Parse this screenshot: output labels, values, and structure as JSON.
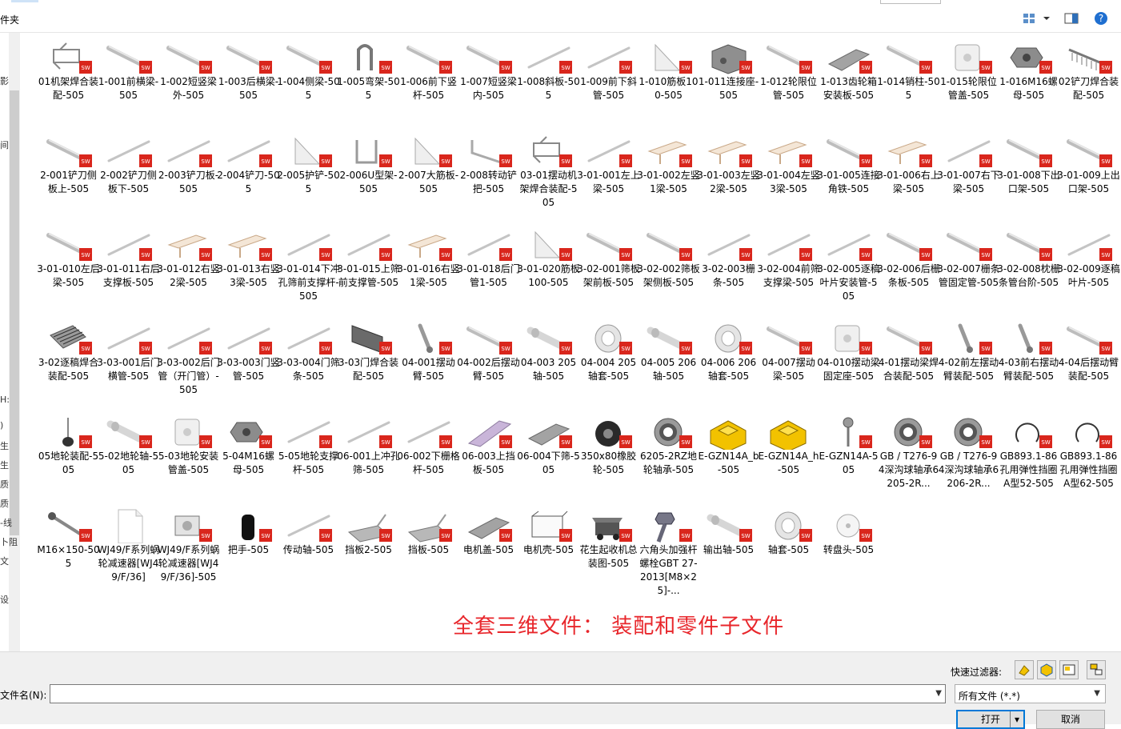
{
  "header": {
    "folder_label_fragment": "件夹"
  },
  "toolbar": {
    "view_icon": "view-mode-icon",
    "dropdown_icon": "chevron-down-icon",
    "preview_pane_icon": "preview-pane-icon",
    "help_icon": "help-icon"
  },
  "left_pane_fragments": [
    "影",
    "间",
    "H:",
    ")",
    "生",
    "生",
    "质",
    "质",
    "-线",
    "卜阻",
    "文",
    "设"
  ],
  "files": [
    {
      "label": "01机架焊合装配-505",
      "shape": "frame",
      "sw": true
    },
    {
      "label": "1-001前横梁-505",
      "shape": "rod",
      "sw": true
    },
    {
      "label": "1-002短竖梁外-505",
      "shape": "rod",
      "sw": true
    },
    {
      "label": "1-003后横梁-505",
      "shape": "rod",
      "sw": true
    },
    {
      "label": "1-004侧梁-505",
      "shape": "rod",
      "sw": true
    },
    {
      "label": "1-005弯架-505",
      "shape": "hook",
      "sw": true
    },
    {
      "label": "1-006前下竖杆-505",
      "shape": "rod",
      "sw": true
    },
    {
      "label": "1-007短竖梁内-505",
      "shape": "rod",
      "sw": true
    },
    {
      "label": "1-008斜板-505",
      "shape": "thinrod",
      "sw": true
    },
    {
      "label": "1-009前下斜管-505",
      "shape": "thinrod",
      "sw": true
    },
    {
      "label": "1-010筋板100-505",
      "shape": "plate",
      "sw": true
    },
    {
      "label": "1-011连接座-505",
      "shape": "block",
      "sw": true
    },
    {
      "label": "1-012轮限位管-505",
      "shape": "rod",
      "sw": true
    },
    {
      "label": "1-013齿轮箱安装板-505",
      "shape": "sheet",
      "sw": true
    },
    {
      "label": "1-014销柱-505",
      "shape": "rod",
      "sw": true
    },
    {
      "label": "1-015轮限位管盖-505",
      "shape": "cap",
      "sw": true
    },
    {
      "label": "1-016M16螺母-505",
      "shape": "nut",
      "sw": true
    },
    {
      "label": "02铲刀焊合装配-505",
      "shape": "comb",
      "sw": true
    },
    {
      "label": "2-001铲刀侧板上-505",
      "shape": "rod",
      "sw": true
    },
    {
      "label": "2-002铲刀侧板下-505",
      "shape": "thinrod",
      "sw": true
    },
    {
      "label": "2-003铲刀板-505",
      "shape": "thinrod",
      "sw": true
    },
    {
      "label": "2-004铲刀-505",
      "shape": "thinrod",
      "sw": true
    },
    {
      "label": "2-005护铲-505",
      "shape": "plate",
      "sw": true
    },
    {
      "label": "2-006U型架-505",
      "shape": "ubar",
      "sw": true
    },
    {
      "label": "2-007大筋板-505",
      "shape": "plate",
      "sw": true
    },
    {
      "label": "2-008转动铲把-505",
      "shape": "lbar",
      "sw": true
    },
    {
      "label": "03-01摆动机架焊合装配-505",
      "shape": "frame",
      "sw": true
    },
    {
      "label": "3-01-001左上梁-505",
      "shape": "thinrod",
      "sw": true
    },
    {
      "label": "3-01-002左竖1梁-505",
      "shape": "bracket",
      "sw": true
    },
    {
      "label": "3-01-003左竖2梁-505",
      "shape": "bracket",
      "sw": true
    },
    {
      "label": "3-01-004左竖3梁-505",
      "shape": "bracket",
      "sw": true
    },
    {
      "label": "3-01-005连接角铁-505",
      "shape": "rod",
      "sw": true
    },
    {
      "label": "3-01-006右上梁-505",
      "shape": "bracket",
      "sw": true
    },
    {
      "label": "3-01-007右下梁-505",
      "shape": "thinrod",
      "sw": true
    },
    {
      "label": "3-01-008下出口架-505",
      "shape": "rod",
      "sw": true
    },
    {
      "label": "3-01-009上出口架-505",
      "shape": "rod",
      "sw": true
    },
    {
      "label": "3-01-010左后梁-505",
      "shape": "rod",
      "sw": true
    },
    {
      "label": "3-01-011右后支撑板-505",
      "shape": "thinrod",
      "sw": true
    },
    {
      "label": "3-01-012右竖2梁-505",
      "shape": "bracket",
      "sw": true
    },
    {
      "label": "3-01-013右竖3梁-505",
      "shape": "bracket",
      "sw": true
    },
    {
      "label": "3-01-014下冲孔筛前支撑杆-505",
      "shape": "thinrod",
      "sw": true
    },
    {
      "label": "3-01-015上筛前支撑管-505",
      "shape": "thinrod",
      "sw": true
    },
    {
      "label": "3-01-016右竖1梁-505",
      "shape": "bracket",
      "sw": true
    },
    {
      "label": "3-01-018后门管1-505",
      "shape": "thinrod",
      "sw": true
    },
    {
      "label": "3-01-020筋板100-505",
      "shape": "plate",
      "sw": true
    },
    {
      "label": "3-02-001筛板架前板-505",
      "shape": "rod",
      "sw": true
    },
    {
      "label": "3-02-002筛板架侧板-505",
      "shape": "rod",
      "sw": true
    },
    {
      "label": "3-02-003栅条-505",
      "shape": "thinrod",
      "sw": true
    },
    {
      "label": "3-02-004前筛支撑梁-505",
      "shape": "thinrod",
      "sw": true
    },
    {
      "label": "3-02-005逐稿叶片安装管-505",
      "shape": "thinrod",
      "sw": true
    },
    {
      "label": "3-02-006后栅条板-505",
      "shape": "rod",
      "sw": true
    },
    {
      "label": "3-02-007栅条管固定管-505",
      "shape": "rod",
      "sw": true
    },
    {
      "label": "3-02-008枕栅条管台阶-505",
      "shape": "rod",
      "sw": true
    },
    {
      "label": "3-02-009逐稿叶片-505",
      "shape": "thinrod",
      "sw": true
    },
    {
      "label": "3-02逐稿焊合装配-505",
      "shape": "grate",
      "sw": true
    },
    {
      "label": "3-03-001后门横管-505",
      "shape": "thinrod",
      "sw": true
    },
    {
      "label": "3-03-002后门管（开门管）-505",
      "shape": "thinrod",
      "sw": true
    },
    {
      "label": "3-03-003门竖管-505",
      "shape": "thinrod",
      "sw": true
    },
    {
      "label": "3-03-004门筛条-505",
      "shape": "thinrod",
      "sw": true
    },
    {
      "label": "3-03门焊合装配-505",
      "shape": "panel",
      "sw": true
    },
    {
      "label": "04-001摆动臂-505",
      "shape": "arm",
      "sw": true
    },
    {
      "label": "04-002后摆动臂-505",
      "shape": "rod",
      "sw": true
    },
    {
      "label": "04-003 205轴-505",
      "shape": "shaft",
      "sw": true
    },
    {
      "label": "04-004 205轴套-505",
      "shape": "sleeve",
      "sw": true
    },
    {
      "label": "04-005 206轴-505",
      "shape": "shaft",
      "sw": true
    },
    {
      "label": "04-006 206轴套-505",
      "shape": "sleeve",
      "sw": true
    },
    {
      "label": "04-007摆动梁-505",
      "shape": "rod",
      "sw": true
    },
    {
      "label": "04-010摆动梁固定座-505",
      "shape": "cap",
      "sw": true
    },
    {
      "label": "4-01摆动梁焊合装配-505",
      "shape": "rod",
      "sw": true
    },
    {
      "label": "4-02前左摆动臂装配-505",
      "shape": "arm",
      "sw": true
    },
    {
      "label": "4-03前右摆动臂装配-505",
      "shape": "arm",
      "sw": true
    },
    {
      "label": "4-04后摆动臂装配-505",
      "shape": "rod",
      "sw": true
    },
    {
      "label": "05地轮装配-505",
      "shape": "pin",
      "sw": true
    },
    {
      "label": "5-02地轮轴-505",
      "shape": "shaft",
      "sw": true
    },
    {
      "label": "5-03地轮安装管盖-505",
      "shape": "cap",
      "sw": true
    },
    {
      "label": "5-04M16螺母-505",
      "shape": "nut",
      "sw": true
    },
    {
      "label": "5-05地轮支撑杆-505",
      "shape": "thinrod",
      "sw": true
    },
    {
      "label": "06-001上冲孔筛-505",
      "shape": "thinrod",
      "sw": true
    },
    {
      "label": "06-002下栅格杆-505",
      "shape": "thinrod",
      "sw": true
    },
    {
      "label": "06-003上挡板-505",
      "shape": "purpleplate",
      "sw": true
    },
    {
      "label": "06-004下筛-505",
      "shape": "sheet",
      "sw": true
    },
    {
      "label": "350x80橡胶轮-505",
      "shape": "wheel",
      "sw": true
    },
    {
      "label": "6205-2RZ地轮轴承-505",
      "shape": "bearing",
      "sw": true
    },
    {
      "label": "E-GZN14A_b-505",
      "shape": "yellow",
      "sw": false
    },
    {
      "label": "E-GZN14A_h-505",
      "shape": "yellow",
      "sw": false
    },
    {
      "label": "E-GZN14A-505",
      "shape": "rodend",
      "sw": true
    },
    {
      "label": "GB / T276-94深沟球轴承6205-2R...",
      "shape": "bearing",
      "sw": true
    },
    {
      "label": "GB / T276-94深沟球轴承6206-2R...",
      "shape": "bearing",
      "sw": true
    },
    {
      "label": "GB893.1-86孔用弹性挡圈A型52-505",
      "shape": "circlip",
      "sw": true
    },
    {
      "label": "GB893.1-86孔用弹性挡圈A型62-505",
      "shape": "circlip",
      "sw": true
    },
    {
      "label": "M16×150-505",
      "shape": "bolt",
      "sw": true
    },
    {
      "label": "WJ49/F系列蜗轮减速器[WJ49/F/36]",
      "shape": "doc",
      "sw": false
    },
    {
      "label": "WJ49/F系列蜗轮减速器[WJ49/F/36]-505",
      "shape": "gearbox",
      "sw": true
    },
    {
      "label": "把手-505",
      "shape": "handle",
      "sw": true
    },
    {
      "label": "传动轴-505",
      "shape": "thinrod",
      "sw": true
    },
    {
      "label": "挡板2-505",
      "shape": "tray",
      "sw": true
    },
    {
      "label": "挡板-505",
      "shape": "tray",
      "sw": true
    },
    {
      "label": "电机盖-505",
      "shape": "sheet",
      "sw": true
    },
    {
      "label": "电机壳-505",
      "shape": "box",
      "sw": true
    },
    {
      "label": "花生起收机总装图-505",
      "shape": "machine",
      "sw": true
    },
    {
      "label": "六角头加强杆螺栓GBT 27-2013[M8×25]-...",
      "shape": "hexbolt",
      "sw": true
    },
    {
      "label": "输出轴-505",
      "shape": "shaft",
      "sw": true
    },
    {
      "label": "轴套-505",
      "shape": "sleeve",
      "sw": true
    },
    {
      "label": "转盘头-505",
      "shape": "disc",
      "sw": true
    }
  ],
  "banner": "全套三维文件： 装配和零件子文件",
  "bottom": {
    "quick_filter_label": "快速过滤器:",
    "filename_label": "文件名(N):",
    "filename_value": "",
    "filetype_value": "所有文件 (*.*)",
    "open_label": "打开",
    "cancel_label": "取消"
  },
  "colors": {
    "sw_badge": "#d9261c",
    "banner": "#e8262b",
    "accent": "#0078d7",
    "yellow_part": "#f2c200"
  }
}
